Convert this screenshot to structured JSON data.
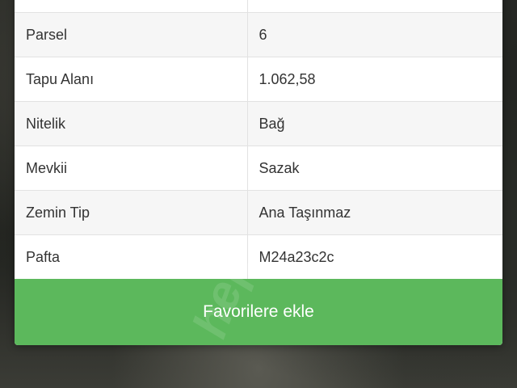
{
  "table": {
    "rows": [
      {
        "key": "",
        "value": ""
      },
      {
        "key": "Parsel",
        "value": "6"
      },
      {
        "key": "Tapu Alanı",
        "value": "1.062,58"
      },
      {
        "key": "Nitelik",
        "value": "Bağ"
      },
      {
        "key": "Mevkii",
        "value": "Sazak"
      },
      {
        "key": "Zemin Tip",
        "value": "Ana Taşınmaz"
      },
      {
        "key": "Pafta",
        "value": "M24a23c2c"
      }
    ]
  },
  "favorite_button": {
    "label": "Favorilere ekle",
    "color": "#5cb85c"
  }
}
